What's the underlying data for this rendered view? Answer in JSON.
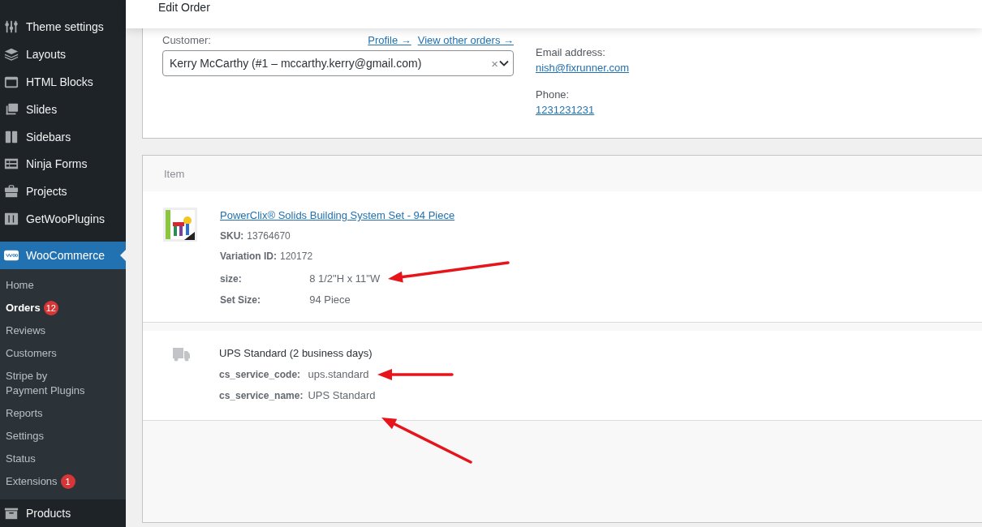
{
  "header": {
    "title": "Edit Order"
  },
  "sidebar": {
    "items": [
      {
        "label": "Theme settings",
        "selected": false
      },
      {
        "label": "Layouts",
        "selected": false
      },
      {
        "label": "HTML Blocks",
        "selected": false
      },
      {
        "label": "Slides",
        "selected": false
      },
      {
        "label": "Sidebars",
        "selected": false
      },
      {
        "label": "Ninja Forms",
        "selected": false
      },
      {
        "label": "Projects",
        "selected": false
      },
      {
        "label": "GetWooPlugins",
        "selected": false
      },
      {
        "label": "WooCommerce",
        "selected": true
      }
    ],
    "submenu": [
      {
        "label": "Home",
        "selected": false
      },
      {
        "label": "Orders",
        "selected": true,
        "badge": "12"
      },
      {
        "label": "Reviews",
        "selected": false
      },
      {
        "label": "Customers",
        "selected": false
      },
      {
        "label": "Stripe by\nPayment Plugins",
        "selected": false
      },
      {
        "label": "Reports",
        "selected": false
      },
      {
        "label": "Settings",
        "selected": false
      },
      {
        "label": "Status",
        "selected": false
      },
      {
        "label": "Extensions",
        "selected": false,
        "badge": "1"
      }
    ],
    "bottom_items": [
      {
        "label": "Products",
        "selected": false
      }
    ]
  },
  "customer": {
    "label": "Customer:",
    "links": [
      "Profile →",
      "View other orders →"
    ],
    "value": "Kerry McCarthy (#1 – mccarthy.kerry@gmail.com)",
    "clear": "×"
  },
  "contact": [
    {
      "label": "Email address:",
      "value": "nish@fixrunner.com"
    },
    {
      "label": "Phone:",
      "value": "1231231231"
    }
  ],
  "items_table": {
    "columns": [
      "Item"
    ],
    "rows": [
      {
        "kind": "product",
        "name": "PowerClix® Solids Building System Set - 94 Piece",
        "lines": [
          {
            "label": "SKU:",
            "value": "13764670"
          },
          {
            "label": "Variation ID:",
            "value": "120172"
          }
        ],
        "meta": [
          {
            "label": "size:",
            "value": "8 1/2\"H x 11\"W"
          },
          {
            "label": "Set Size:",
            "value": "94 Piece"
          }
        ]
      },
      {
        "kind": "shipping",
        "name": "UPS Standard (2 business days)",
        "meta": [
          {
            "label": "cs_service_code:",
            "value": "ups.standard"
          },
          {
            "label": "cs_service_name:",
            "value": "UPS Standard"
          }
        ]
      }
    ]
  }
}
